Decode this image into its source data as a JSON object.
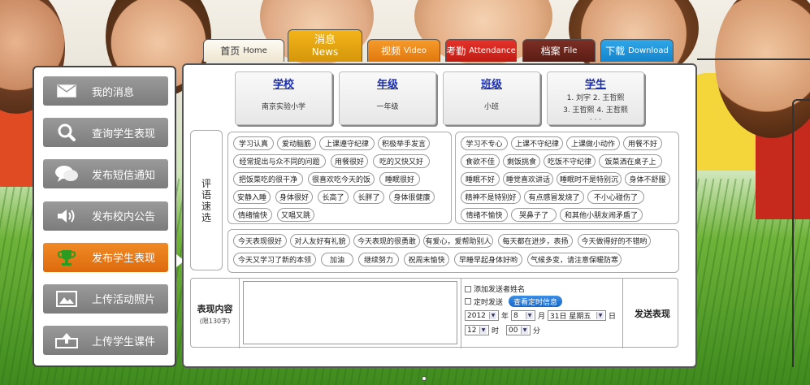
{
  "tabs": [
    {
      "zh": "首页",
      "en": "Home"
    },
    {
      "zh": "消息",
      "en": "News"
    },
    {
      "zh": "视频",
      "en": "Video"
    },
    {
      "zh": "考勤",
      "en": "Attendance"
    },
    {
      "zh": "档案",
      "en": "File"
    },
    {
      "zh": "下载",
      "en": "Download"
    }
  ],
  "menu": [
    {
      "label": "我的消息",
      "icon": "envelope-icon"
    },
    {
      "label": "查询学生表现",
      "icon": "search-icon"
    },
    {
      "label": "发布短信通知",
      "icon": "chat-bubble-icon"
    },
    {
      "label": "发布校内公告",
      "icon": "speaker-icon"
    },
    {
      "label": "发布学生表现",
      "icon": "trophy-icon"
    },
    {
      "label": "上传活动照片",
      "icon": "image-icon"
    },
    {
      "label": "上传学生课件",
      "icon": "upload-icon"
    }
  ],
  "active_menu": "发布学生表现",
  "categories": {
    "school": {
      "title": "学校",
      "value": "南京实验小学"
    },
    "grade": {
      "title": "年级",
      "value": "一年级"
    },
    "class": {
      "title": "班级",
      "value": "小班"
    },
    "student": {
      "title": "学生",
      "line1": "1. 刘宇    2. 王哲熙",
      "line2": "3. 王哲熙  4. 王哲熙",
      "more": "· · ·"
    }
  },
  "comment_label": "评语速选",
  "positive_comments": [
    "学习认真",
    "爱动脑筋",
    "上课遵守纪律",
    "积极举手发言",
    "经常提出与众不同的问题",
    "用餐很好",
    "吃的又快又好",
    "把饭菜吃的很干净",
    "很喜欢吃今天的饭",
    "睡眠很好",
    "安静入睡",
    "身体很好",
    "长高了",
    "长胖了",
    "身体很健康",
    "情绪愉快",
    "又唱又跳"
  ],
  "negative_comments": [
    "学习不专心",
    "上课不守纪律",
    "上课做小动作",
    "用餐不好",
    "食欲不佳",
    "剩饭挑食",
    "吃饭不守纪律",
    "饭菜洒在桌子上",
    "睡眠不好",
    "睡觉喜欢讲话",
    "睡眠时不是特别沉",
    "身体不舒服",
    "精神不是特别好",
    "有点感冒发烧了",
    "不小心碰伤了",
    "情绪不愉快",
    "哭鼻子了",
    "和其他小朋友闹矛盾了"
  ],
  "general_comments": [
    "今天表现很好",
    "对人友好有礼貌",
    "今天表现的很勇敢",
    "有爱心，爱帮助别人",
    "每天都在进步，表扬",
    "今天做得好的不错哟",
    "今天又学习了新的本领",
    "加油",
    "继续努力",
    "祝周末愉快",
    "早睡早起身体好哟",
    "气候多变，请注意保暖防寒"
  ],
  "form": {
    "label": "表现内容",
    "hint": "(限130字)",
    "add_sender_name": "添加发送者姓名",
    "scheduled_send": "定时发送",
    "view_schedule": "查看定时信息",
    "year": "2012",
    "year_unit": "年",
    "month": "8",
    "month_unit": "月",
    "day_sel": "31日 星期五",
    "day_unit": "日",
    "hour": "12",
    "hour_unit": "时",
    "minute": "00",
    "minute_unit": "分",
    "send": "发送表现"
  }
}
